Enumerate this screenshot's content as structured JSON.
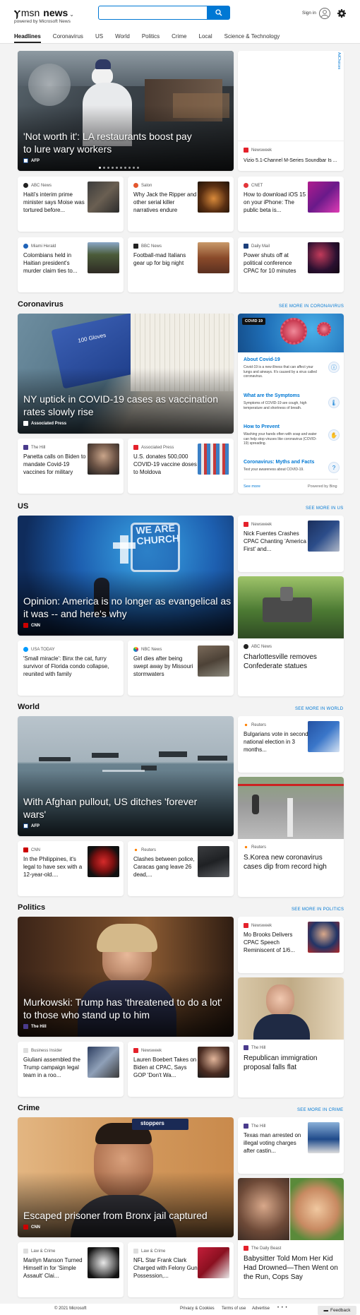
{
  "header": {
    "brand": "msn",
    "section": "news",
    "powered_by": "powered by Microsoft News",
    "search_placeholder": "",
    "signin": "Sign in"
  },
  "nav": [
    "Headlines",
    "Coronavirus",
    "US",
    "World",
    "Politics",
    "Crime",
    "Local",
    "Science & Technology"
  ],
  "top": {
    "hero": {
      "title": "'Not worth it': LA restaurants boost pay to lure wary workers",
      "source": "AFP"
    },
    "ad": {
      "label": "AdChoices",
      "source": "Newsweek",
      "title": "Vizio 5.1-Channel M-Series Soundbar Is ..."
    },
    "cards": [
      {
        "source": "ABC News",
        "title": "Haiti's interim prime minister says Moise was tortured before..."
      },
      {
        "source": "Salon",
        "title": "Why Jack the Ripper and other serial killer narratives endure"
      },
      {
        "source": "CNET",
        "title": "How to download iOS 15 on your iPhone: The public beta is..."
      },
      {
        "source": "Miami Herald",
        "title": "Colombians held in Haitian president's murder claim ties to..."
      },
      {
        "source": "BBC News",
        "title": "Football-mad Italians gear up for big night"
      },
      {
        "source": "Daily Mail",
        "title": "Power shuts off at political conference CPAC for 10 minutes"
      }
    ]
  },
  "coronavirus": {
    "title": "Coronavirus",
    "see_more": "SEE MORE IN CORONAVIRUS",
    "hero": {
      "title": "NY uptick in COVID-19 cases as vaccination rates slowly rise",
      "source": "Associated Press",
      "box_label": "100 Gloves"
    },
    "panel": {
      "badge": "COVID 19",
      "items": [
        {
          "title": "About Covid-19",
          "desc": "Covid-19 is a new illness that can affect your lungs and airways. It's caused by a virus called coronavirus."
        },
        {
          "title": "What are the Symptoms",
          "desc": "Symptoms of COVID-19 are cough, high temperature and shortness of breath."
        },
        {
          "title": "How to Prevent",
          "desc": "Washing your hands often with soap and water can help stop viruses like coronavirus (COVID-19) spreading."
        },
        {
          "title": "Coronavirus: Myths and Facts",
          "desc": "Test your awareness about COVID-19."
        }
      ],
      "see_more": "See more",
      "powered": "Powered by Bing"
    },
    "cards": [
      {
        "source": "The Hill",
        "title": "Panetta calls on Biden to mandate Covid-19 vaccines for military"
      },
      {
        "source": "Associated Press",
        "title": "U.S. donates 500,000 COVID-19 vaccine doses to Moldova"
      }
    ]
  },
  "us": {
    "title": "US",
    "see_more": "SEE MORE IN US",
    "hero": {
      "title": "Opinion: America is no longer as evangelical as it was -- and here's why",
      "source": "CNN",
      "sign": "WE ARE CHURCH"
    },
    "side": [
      {
        "source": "Newsweek",
        "title": "Nick Fuentes Crashes CPAC Chanting 'America First' and..."
      },
      {
        "source": "ABC News",
        "title": "Charlottesville removes Confederate statues"
      }
    ],
    "cards": [
      {
        "source": "USA TODAY",
        "title": "'Small miracle': Binx the cat, furry survivor of Florida condo collapse, reunited with family"
      },
      {
        "source": "NBC News",
        "title": "Girl dies after being swept away by Missouri stormwaters"
      }
    ]
  },
  "world": {
    "title": "World",
    "see_more": "SEE MORE IN WORLD",
    "hero": {
      "title": "With Afghan pullout, US ditches 'forever wars'",
      "source": "AFP"
    },
    "side": [
      {
        "source": "Reuters",
        "title": "Bulgarians vote in second national election in 3 months..."
      },
      {
        "source": "Reuters",
        "title": "S.Korea new coronavirus cases dip from record high"
      }
    ],
    "cards": [
      {
        "source": "CNN",
        "title": "In the Philippines, it's legal to have sex with a 12-year-old...."
      },
      {
        "source": "Reuters",
        "title": "Clashes between police, Caracas gang leave 26 dead,..."
      }
    ]
  },
  "politics": {
    "title": "Politics",
    "see_more": "SEE MORE IN POLITICS",
    "hero": {
      "title": "Murkowski: Trump has 'threatened to do a lot' to those who stand up to him",
      "source": "The Hill"
    },
    "side": [
      {
        "source": "Newsweek",
        "title": "Mo Brooks Delivers CPAC Speech Reminiscent of 1/6..."
      },
      {
        "source": "The Hill",
        "title": "Republican immigration proposal falls flat"
      }
    ],
    "cards": [
      {
        "source": "Business Insider",
        "title": "Giuliani assembled the Trump campaign legal team in a roo..."
      },
      {
        "source": "Newsweek",
        "title": "Lauren Boebert Takes on Biden at CPAC, Says GOP 'Don't Wa..."
      }
    ]
  },
  "crime": {
    "title": "Crime",
    "see_more": "SEE MORE IN CRIME",
    "hero": {
      "title": "Escaped prisoner from Bronx jail captured",
      "source": "CNN",
      "badge": "stoppers"
    },
    "side": [
      {
        "source": "The Hill",
        "title": "Texas man arrested on illegal voting charges after castin..."
      },
      {
        "source": "The Daily Beast",
        "title": "Babysitter Told Mom Her Kid Had Drowned—Then Went on the Run, Cops Say"
      }
    ],
    "cards": [
      {
        "source": "Law & Crime",
        "title": "Marilyn Manson Turned Himself in for 'Simple Assault' Clai..."
      },
      {
        "source": "Law & Crime",
        "title": "NFL Star Frank Clark Charged with Felony Gun Possession,..."
      }
    ]
  },
  "footer": {
    "copyright": "© 2021 Microsoft",
    "links": [
      "Privacy & Cookies",
      "Terms of use",
      "Advertise"
    ],
    "more": "• • •",
    "feedback": "Feedback"
  },
  "colors": {
    "accent": "#0078d4",
    "cnn": "#cc0000",
    "newsweek": "#e4212b",
    "reuters": "#ff8000",
    "abc": "#222222",
    "hill": "#4a3b8c"
  }
}
